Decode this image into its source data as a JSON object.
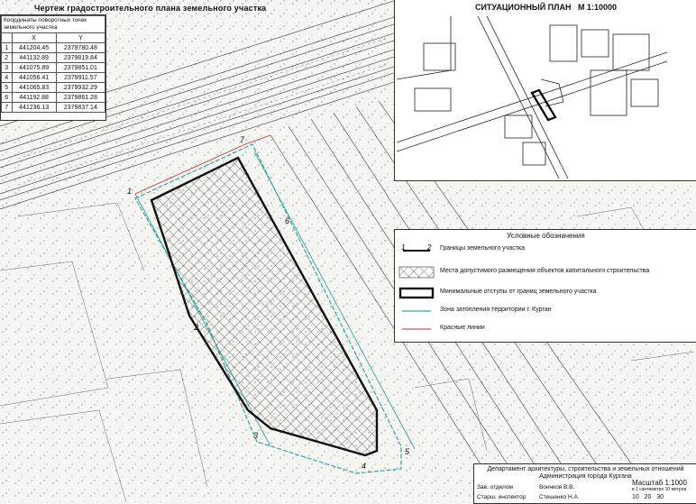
{
  "main_title": "Чертеж градостроительного плана земельного участка",
  "coordinates": {
    "header": "Координаты поворотных точек земельного участка",
    "col_x": "X",
    "col_y": "Y",
    "rows": [
      {
        "n": "1",
        "x": "441204.45",
        "y": "2379780.48"
      },
      {
        "n": "2",
        "x": "441132.89",
        "y": "2379819.84"
      },
      {
        "n": "3",
        "x": "441075.89",
        "y": "2379851.01"
      },
      {
        "n": "4",
        "x": "441056.41",
        "y": "2379911.57"
      },
      {
        "n": "5",
        "x": "441065.83",
        "y": "2379932.29"
      },
      {
        "n": "6",
        "x": "441192.88",
        "y": "2379861.28"
      },
      {
        "n": "7",
        "x": "441236.13",
        "y": "2379837.14"
      }
    ]
  },
  "situation_plan": {
    "title": "СИТУАЦИОННЫЙ ПЛАН",
    "scale": "М 1:10000"
  },
  "legend": {
    "title": "Условные обозначения",
    "items": [
      {
        "symbol": "1 2",
        "label": "Границы земельного участка"
      },
      {
        "label": "Места допустимого размещения объектов капитального строительства"
      },
      {
        "label": "Минимальные отступы от границ земельного участка"
      },
      {
        "label": "Зона затопления территории г. Курган"
      },
      {
        "label": "Красные линии"
      }
    ]
  },
  "point_labels": [
    "1",
    "2",
    "3",
    "4",
    "5",
    "6",
    "7"
  ],
  "stamp": {
    "dept": "Департамент архитектуры, строительства и земельных отношений",
    "admin": "Администрация города Кургана",
    "role1": "Зав. отделом",
    "name1": "Воинков В.В.",
    "role2": "Старш. инспектор",
    "name2": "Стешенко Н.А",
    "scale": "Масштаб 1:1000",
    "scale_note": "в 1 сантиметре 10 метров",
    "ticks": "10   20   30"
  },
  "colors": {
    "boundary": "#111111",
    "flood_zone": "#3aa5a0",
    "red_line": "#b03030",
    "hatch": "#222222"
  }
}
